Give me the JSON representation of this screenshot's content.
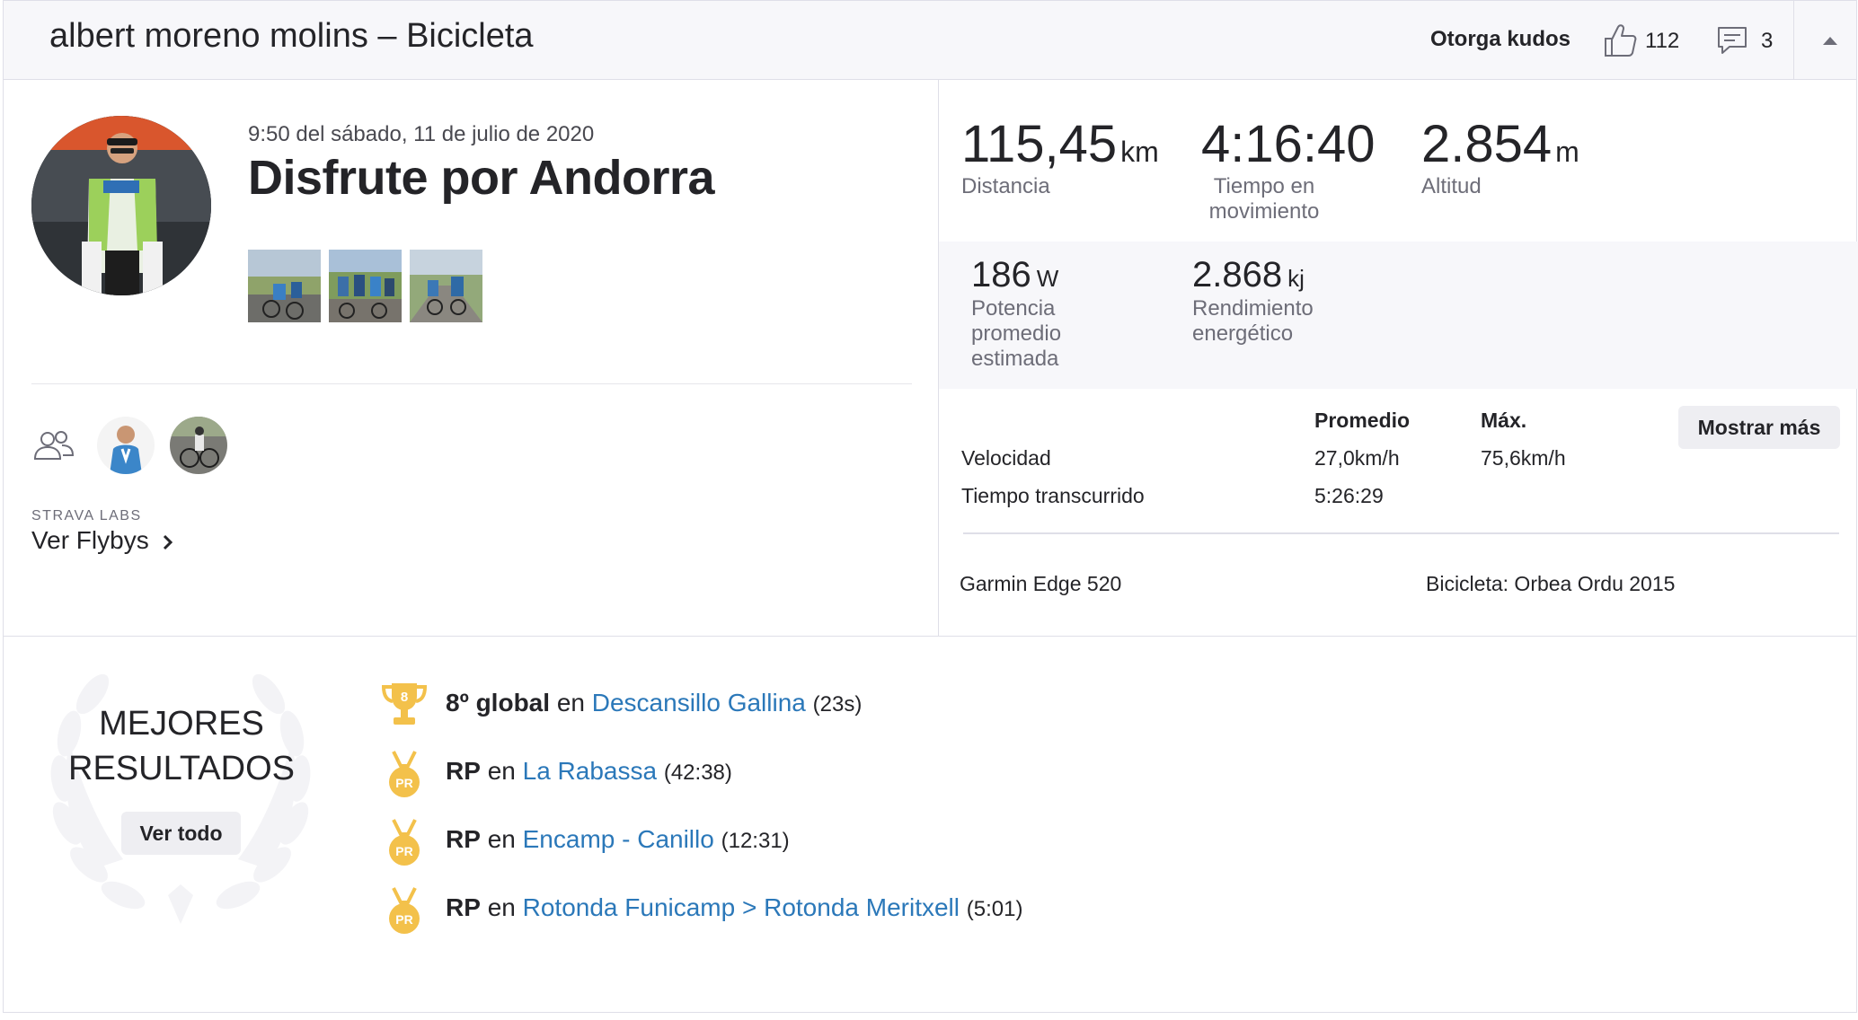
{
  "header": {
    "title": "albert moreno molins – Bicicleta",
    "kudos_label": "Otorga kudos",
    "kudos_count": "112",
    "comments_count": "3"
  },
  "activity": {
    "date": "9:50 del sábado, 11 de julio de 2020",
    "title": "Disfrute por Andorra"
  },
  "side": {
    "labs_label": "STRAVA LABS",
    "flyby_link": "Ver Flybys"
  },
  "stats": {
    "primary": [
      {
        "value": "115,45",
        "unit": "km",
        "label": "Distancia"
      },
      {
        "value": "4:16:40",
        "unit": "",
        "label": "Tiempo en movimiento"
      },
      {
        "value": "2.854",
        "unit": "m",
        "label": "Altitud"
      }
    ],
    "secondary": [
      {
        "value": "186",
        "unit": "W",
        "label": "Potencia promedio estimada"
      },
      {
        "value": "2.868",
        "unit": "kj",
        "label": "Rendimiento energético"
      }
    ]
  },
  "more_stats": {
    "header_avg": "Promedio",
    "header_max": "Máx.",
    "button": "Mostrar más",
    "rows": [
      {
        "label": "Velocidad",
        "avg": "27,0km/h",
        "max": "75,6km/h"
      },
      {
        "label": "Tiempo transcurrido",
        "avg": "5:26:29",
        "max": ""
      }
    ]
  },
  "equipment": {
    "device": "Garmin Edge 520",
    "bike": "Bicicleta: Orbea Ordu 2015"
  },
  "best_results": {
    "title_line1": "MEJORES",
    "title_line2": "RESULTADOS",
    "view_all": "Ver todo",
    "items": [
      {
        "icon": "trophy-icon",
        "badge": "8",
        "rank": "8º global",
        "prep": "en",
        "segment": "Descansillo Gallina",
        "time": "(23s)"
      },
      {
        "icon": "pr-medal-icon",
        "badge": "PR",
        "rank": "RP",
        "prep": "en",
        "segment": "La Rabassa",
        "time": "(42:38)"
      },
      {
        "icon": "pr-medal-icon",
        "badge": "PR",
        "rank": "RP",
        "prep": "en",
        "segment": "Encamp - Canillo",
        "time": "(12:31)"
      },
      {
        "icon": "pr-medal-icon",
        "badge": "PR",
        "rank": "RP",
        "prep": "en",
        "segment": "Rotonda Funicamp > Rotonda Meritxell",
        "time": "(5:01)"
      }
    ]
  },
  "colors": {
    "accent_link": "#2b78b9",
    "medal_gold": "#f3c14b",
    "header_bg": "#f7f7fa"
  }
}
